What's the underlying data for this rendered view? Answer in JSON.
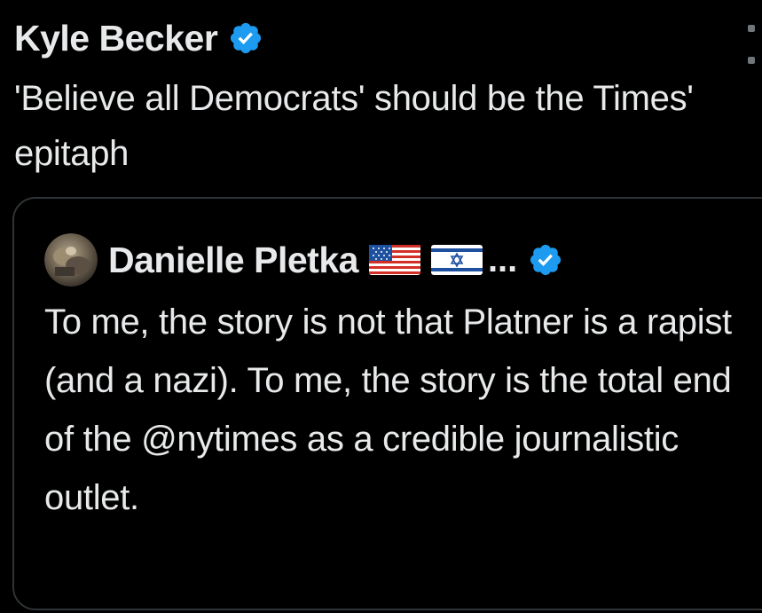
{
  "post": {
    "author_name": "Kyle Becker",
    "text": "'Believe all Democrats' should be the Times' epitaph",
    "icons": {
      "verified": "verified-badge-icon",
      "more": "more-vertical-icon"
    }
  },
  "quoted_post": {
    "author_name": "Danielle Pletka",
    "name_overflow": "...",
    "text": "To me, the story is not that Platner is a rapist (and a nazi). To me, the story is the total end of the @nytimes as a credible journalistic outlet.",
    "icons": {
      "avatar": "avatar",
      "flag_1": "us-flag-icon",
      "flag_2": "israel-flag-icon",
      "verified": "verified-badge-icon"
    }
  },
  "colors": {
    "background": "#000000",
    "text": "#e7e9ea",
    "verified_blue": "#1d9bf0",
    "border": "#2f3336",
    "muted": "#71767b"
  }
}
